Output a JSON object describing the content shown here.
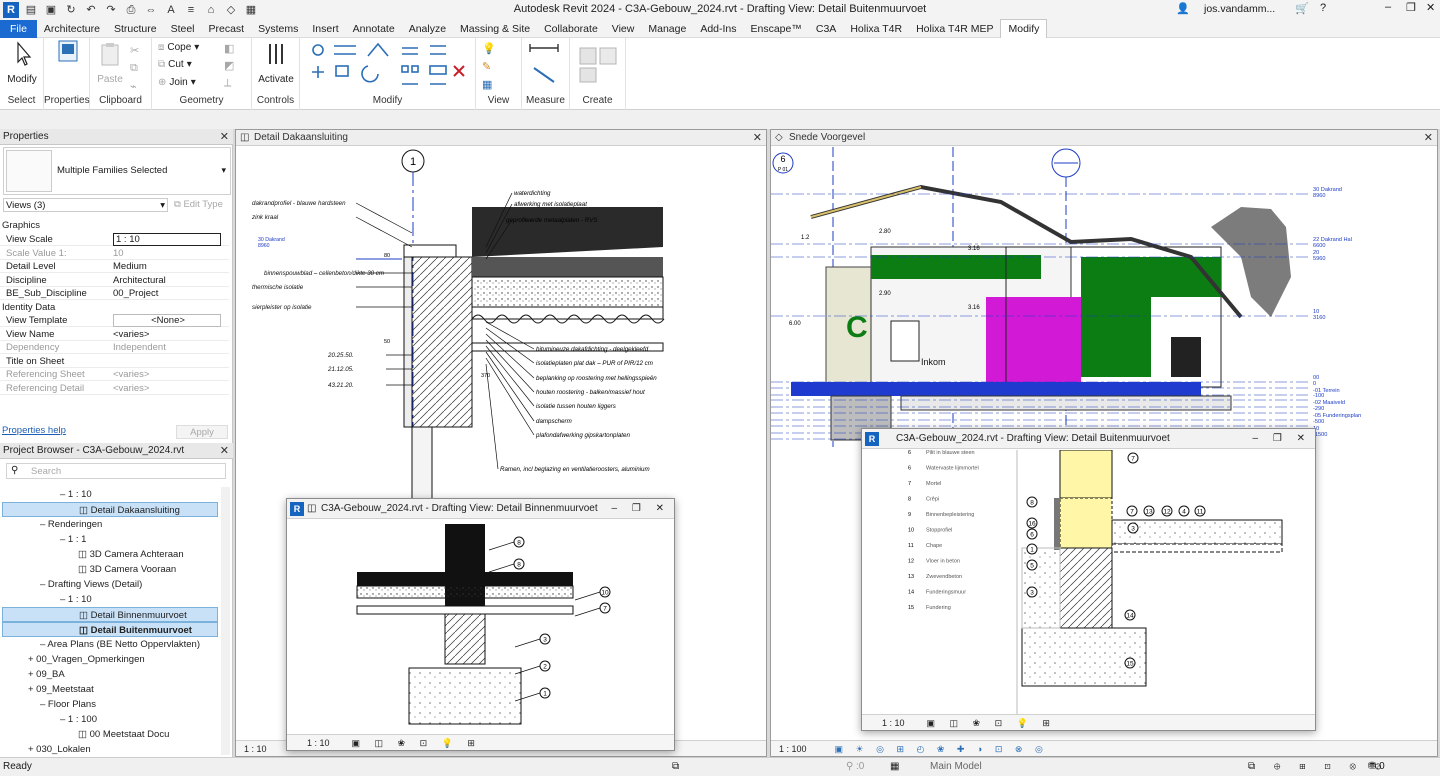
{
  "window": {
    "title": "Autodesk Revit 2024 - C3A-Gebouw_2024.rvt - Drafting View: Detail Buitenmuurvoet",
    "user": "jos.vandamm..."
  },
  "menu": {
    "tabs": [
      "File",
      "Architecture",
      "Structure",
      "Steel",
      "Precast",
      "Systems",
      "Insert",
      "Annotate",
      "Analyze",
      "Massing & Site",
      "Collaborate",
      "View",
      "Manage",
      "Add-Ins",
      "Enscape™",
      "C3A",
      "Holixa T4R",
      "Holixa T4R MEP",
      "Modify"
    ],
    "active": "Modify"
  },
  "ribbon": {
    "modify_label": "Modify",
    "select_label": "Select",
    "properties_label": "Properties",
    "paste_label": "Paste",
    "clipboard_label": "Clipboard",
    "cope_label": "Cope",
    "cut_label": "Cut",
    "join_label": "Join",
    "geometry_label": "Geometry",
    "activate_label": "Activate",
    "controls_label": "Controls",
    "modify_panel_label": "Modify",
    "view_label": "View",
    "measure_label": "Measure",
    "create_label": "Create"
  },
  "properties": {
    "header": "Properties",
    "type_name": "Multiple Families Selected",
    "filter": "Views (3)",
    "edit_type": "Edit Type",
    "sections": {
      "graphics": "Graphics",
      "identity": "Identity Data"
    },
    "rows_graphics": [
      {
        "k": "View Scale",
        "v": "1 : 10",
        "dis": false
      },
      {
        "k": "Scale Value  1:",
        "v": "10",
        "dis": true
      },
      {
        "k": "Detail Level",
        "v": "Medium",
        "dis": false
      },
      {
        "k": "Discipline",
        "v": "Architectural",
        "dis": false
      },
      {
        "k": "BE_Sub_Discipline",
        "v": "00_Project",
        "dis": false
      }
    ],
    "rows_identity": [
      {
        "k": "View Template",
        "v": "<None>",
        "dis": false
      },
      {
        "k": "View Name",
        "v": "<varies>",
        "dis": false
      },
      {
        "k": "Dependency",
        "v": "Independent",
        "dis": true
      },
      {
        "k": "Title on Sheet",
        "v": "",
        "dis": false
      },
      {
        "k": "Referencing Sheet",
        "v": "<varies>",
        "dis": true
      },
      {
        "k": "Referencing Detail",
        "v": "<varies>",
        "dis": true
      }
    ],
    "help": "Properties help",
    "apply": "Apply"
  },
  "browser": {
    "header": "Project Browser - C3A-Gebouw_2024.rvt",
    "search": "Search",
    "items": [
      {
        "t": "1 : 10",
        "x": 60,
        "sel": false
      },
      {
        "t": "Detail Dakaansluiting",
        "x": 78,
        "sel": true
      },
      {
        "t": "Renderingen",
        "x": 40,
        "sel": false
      },
      {
        "t": "1 : 1",
        "x": 60,
        "sel": false
      },
      {
        "t": "3D Camera Achteraan",
        "x": 78,
        "sel": false
      },
      {
        "t": "3D Camera Vooraan",
        "x": 78,
        "sel": false
      },
      {
        "t": "Drafting Views (Detail)",
        "x": 40,
        "sel": false
      },
      {
        "t": "1 : 10",
        "x": 60,
        "sel": false
      },
      {
        "t": "Detail Binnenmuurvoet",
        "x": 78,
        "sel": true
      },
      {
        "t": "Detail Buitenmuurvoet",
        "x": 78,
        "sel": true,
        "bold": true
      },
      {
        "t": "Area Plans (BE Netto Oppervlakten)",
        "x": 40,
        "sel": false
      },
      {
        "t": "00_Vragen_Opmerkingen",
        "x": 28,
        "sel": false
      },
      {
        "t": "09_BA",
        "x": 28,
        "sel": false
      },
      {
        "t": "09_Meetstaat",
        "x": 28,
        "sel": false
      },
      {
        "t": "Floor Plans",
        "x": 40,
        "sel": false
      },
      {
        "t": "1 : 100",
        "x": 60,
        "sel": false
      },
      {
        "t": "00 Meetstaat Docu",
        "x": 78,
        "sel": false
      },
      {
        "t": "030_Lokalen",
        "x": 28,
        "sel": false
      }
    ]
  },
  "views": {
    "dakaansluiting": {
      "title": "Detail Dakaansluiting",
      "scale": "1 : 10"
    },
    "voorgevel": {
      "title": "Snede Voorgevel",
      "scale": "1 : 100"
    },
    "binnenmuurvoet": {
      "title": "C3A-Gebouw_2024.rvt - Drafting View: Detail Binnenmuurvoet",
      "scale": "1 : 10"
    },
    "buitenmuurvoet": {
      "title": "C3A-Gebouw_2024.rvt - Drafting View: Detail Buitenmuurvoet",
      "scale": "1 : 10"
    }
  },
  "dak_labels": {
    "top": [
      "waterdichting",
      "afwerking met isolatieplaat",
      "geprofileerde metaalplaten - RVS"
    ],
    "left": [
      "dakrandprofiel - blauwe hardsteen",
      "zink kraal",
      "30 Dakrand",
      "8960",
      "binnenspouwblad – cellenbeton/dikte 30 cm",
      "thermische isolatie",
      "sierpleister op isolatie",
      "20.25.50.",
      "21.12.05.",
      "43.21.20."
    ],
    "right": [
      "bitumineuze dakafdichting - deelgekleefd",
      "isolatieplaten plat dak – PUR of PIR/12 cm",
      "beplanking op roostering met hellingsspieën",
      "houten roostering - balken/massief hout",
      "isolatie tussen houten liggers",
      "dampscherm",
      "plafondafwerking gipskartonplaten",
      "Ramen, incl beglazing en ventilatieroosters, aluminium"
    ],
    "grid": "1",
    "dims": [
      "80",
      "50",
      "370"
    ]
  },
  "snede_labels": {
    "levels": [
      "30 Dakrand",
      "8960",
      "22 Dakrand Hal",
      "6600",
      "20",
      "5960",
      "10",
      "3160",
      "00",
      "0",
      "-01 Terrein",
      "-100",
      "-02 Maaiveld",
      "-290",
      "-05 Funderingsplan",
      "-500",
      "10",
      "-1500"
    ],
    "grid_a": "6",
    "grid_a_sub": "P 01",
    "inkom": "Inkom",
    "dims": [
      "3.16",
      "3.16",
      "2.80",
      "1.2",
      "2.90",
      "6.00"
    ]
  },
  "buiten_legend": [
    {
      "n": "6",
      "t": "Pilit in blauwe steen"
    },
    {
      "n": "6",
      "t": "Watervaste lijmmortel"
    },
    {
      "n": "7",
      "t": "Mortel"
    },
    {
      "n": "8",
      "t": "Crêpi"
    },
    {
      "n": "9",
      "t": "Binnenbepleistering"
    },
    {
      "n": "10",
      "t": "Stopprofiel"
    },
    {
      "n": "11",
      "t": "Chape"
    },
    {
      "n": "12",
      "t": "Vloer in beton"
    },
    {
      "n": "13",
      "t": "Zwevendbeton"
    },
    {
      "n": "14",
      "t": "Funderingsmuur"
    },
    {
      "n": "15",
      "t": "Fundering"
    }
  ],
  "buiten_tags": [
    "7",
    "8",
    "16",
    "6",
    "1",
    "5",
    "3",
    "7",
    "13",
    "3",
    "12",
    "4",
    "11",
    "3",
    "14",
    "15"
  ],
  "binnen_tags": [
    "8",
    "8",
    "10",
    "7",
    "3",
    "2",
    "1"
  ],
  "status": {
    "left": "Ready",
    "mid": "Main Model",
    "zero": ":0"
  },
  "colors": {
    "accent": "#1b6ad2",
    "green": "#0b7d12",
    "magenta": "#d21ad6",
    "yellow": "#fff6a8",
    "selection": "#c8e1f7"
  }
}
